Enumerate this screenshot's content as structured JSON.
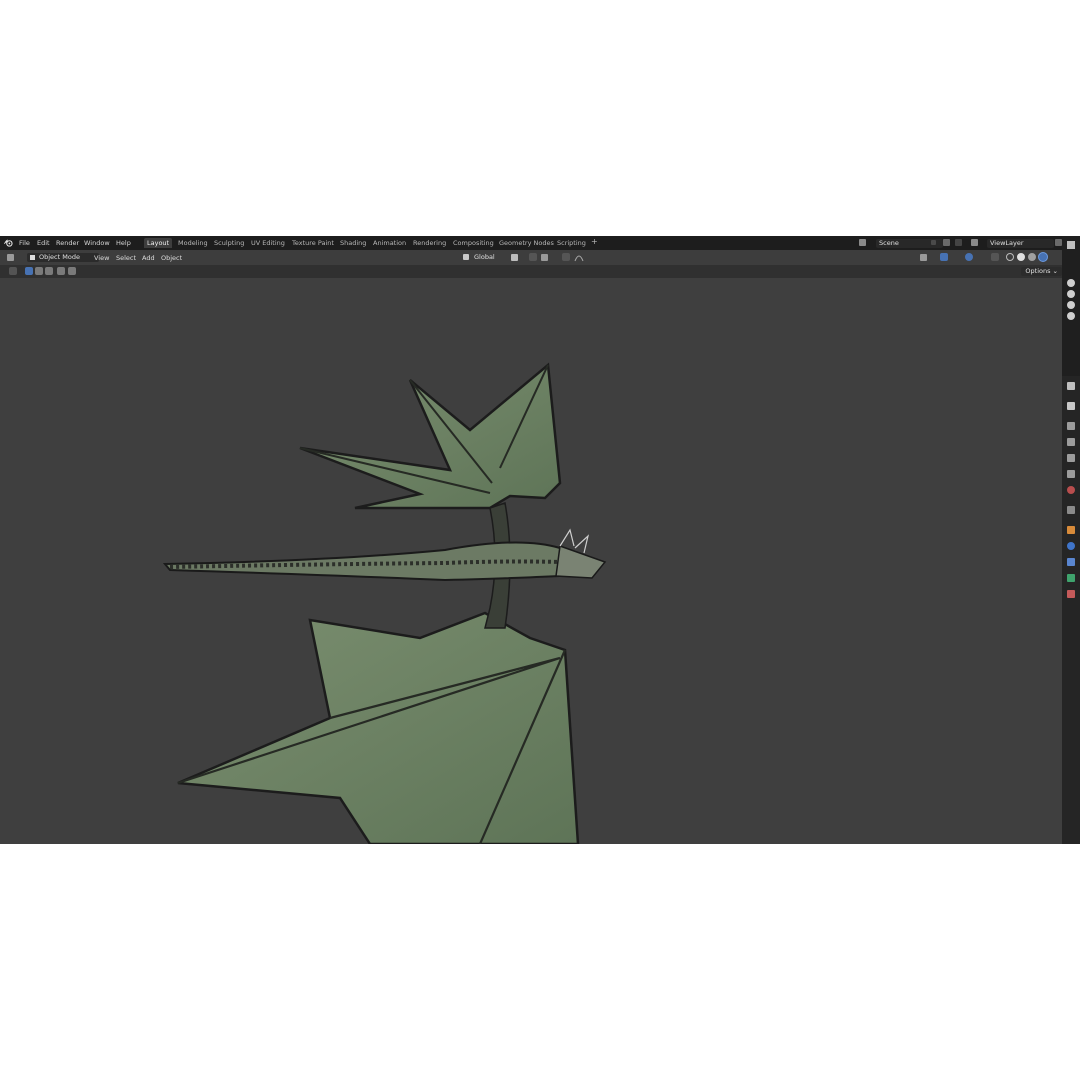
{
  "menu": [
    "File",
    "Edit",
    "Render",
    "Window",
    "Help"
  ],
  "workspaces": [
    "Layout",
    "Modeling",
    "Sculpting",
    "UV Editing",
    "Texture Paint",
    "Shading",
    "Animation",
    "Rendering",
    "Compositing",
    "Geometry Nodes",
    "Scripting"
  ],
  "active_workspace": "Layout",
  "add_workspace": "+",
  "scene": {
    "name": "Scene"
  },
  "view_layer": {
    "name": "ViewLayer"
  },
  "header": {
    "mode": "Object Mode",
    "menus": [
      "View",
      "Select",
      "Add",
      "Object"
    ],
    "orientation": "Global",
    "caret": "⌄"
  },
  "toolbar": {
    "options": "Options ⌄"
  },
  "colors": {
    "accent": "#4772b3",
    "active_tab": "#3d3d3d",
    "viewport": "#3f3f3f",
    "dragon_wing": "#6f8566"
  }
}
